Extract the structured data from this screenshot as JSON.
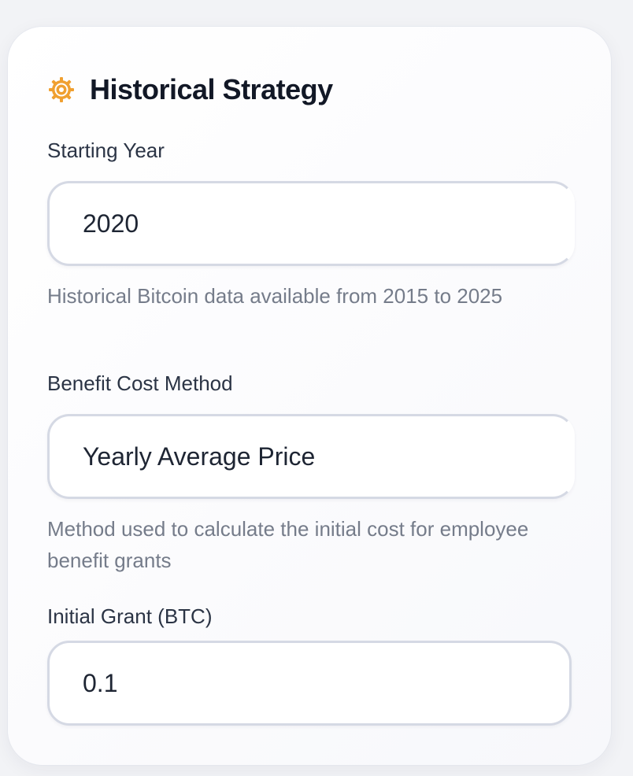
{
  "section": {
    "title": "Historical Strategy",
    "icon": "gear-icon",
    "icon_color": "#f0a030"
  },
  "fields": {
    "starting_year": {
      "label": "Starting Year",
      "value": "2020",
      "help": "Historical Bitcoin data available from 2015 to 2025"
    },
    "benefit_cost_method": {
      "label": "Benefit Cost Method",
      "value": "Yearly Average Price",
      "help": "Method used to calculate the initial cost for employee benefit grants"
    },
    "initial_grant": {
      "label": "Initial Grant (BTC)",
      "value": "0.1"
    }
  }
}
